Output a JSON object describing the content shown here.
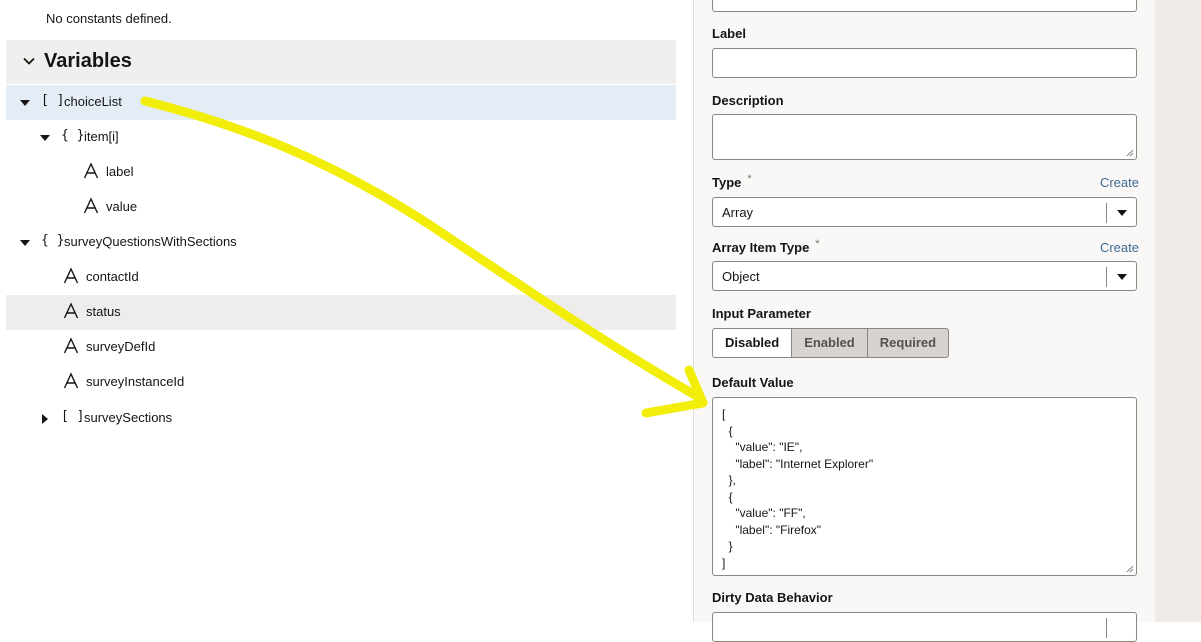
{
  "tree": {
    "no_constants": "No constants defined.",
    "variables_title": "Variables",
    "rows": [
      {
        "icon": "[]",
        "label": "choiceList"
      },
      {
        "icon": "{}",
        "label": "item[i]"
      },
      {
        "icon": "A",
        "label": "label"
      },
      {
        "icon": "A",
        "label": "value"
      },
      {
        "icon": "{}",
        "label": "surveyQuestionsWithSections"
      },
      {
        "icon": "A",
        "label": "contactId"
      },
      {
        "icon": "A",
        "label": "status"
      },
      {
        "icon": "A",
        "label": "surveyDefId"
      },
      {
        "icon": "A",
        "label": "surveyInstanceId"
      },
      {
        "icon": "[]",
        "label": "surveySections"
      }
    ]
  },
  "props": {
    "label_label": "Label",
    "description_label": "Description",
    "type_label": "Type",
    "type_required": "*",
    "type_create": "Create",
    "type_value": "Array",
    "array_item_type_label": "Array Item Type",
    "array_item_type_required": "*",
    "array_item_type_create": "Create",
    "array_item_type_value": "Object",
    "input_parameter_label": "Input Parameter",
    "input_parameter_options": [
      "Disabled",
      "Enabled",
      "Required"
    ],
    "input_parameter_selected": "Disabled",
    "default_value_label": "Default Value",
    "default_value_text": "[\n  {\n    \"value\": \"IE\",\n    \"label\": \"Internet Explorer\"\n  },\n  {\n    \"value\": \"FF\",\n    \"label\": \"Firefox\"\n  }\n]",
    "dirty_data_label": "Dirty Data Behavior"
  },
  "colors": {
    "annotation_arrow": "#f2ee0a",
    "selected_row": "#e4edf5",
    "link": "#3f6b95"
  }
}
